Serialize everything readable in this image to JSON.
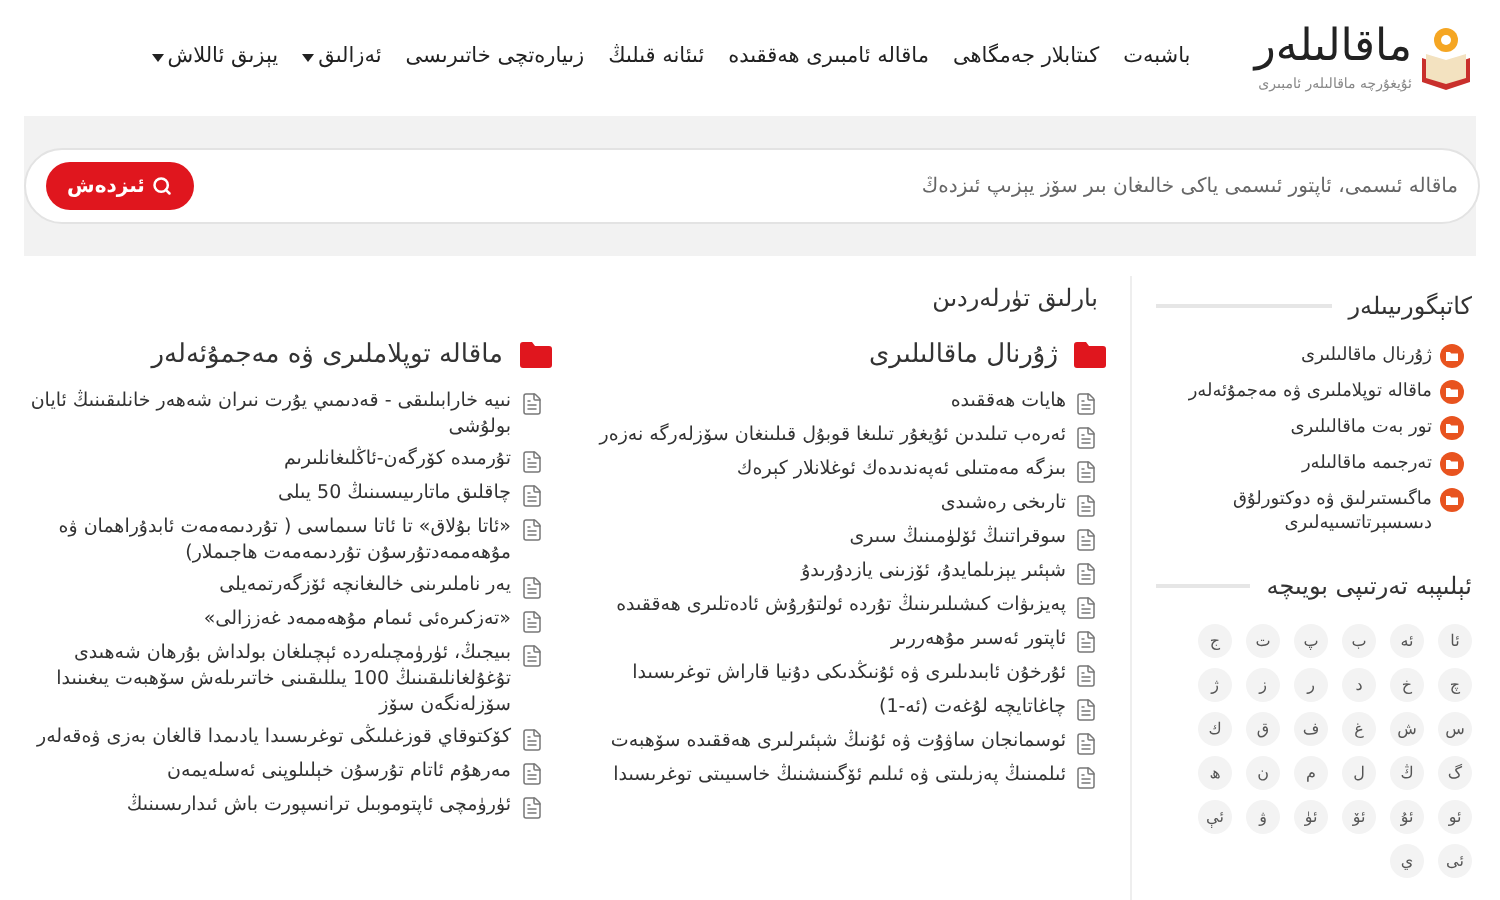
{
  "logo": {
    "title": "ماقالىلەر",
    "subtitle": "ئۇيغۇرچە ماقالىلەر ئامبىرى"
  },
  "nav": [
    {
      "label": "باشبەت",
      "kind": "link"
    },
    {
      "label": "كىتابلار جەمگاھى",
      "kind": "link"
    },
    {
      "label": "ماقالە ئامبىرى ھەققىدە",
      "kind": "link"
    },
    {
      "label": "ئىئانە قىلىڭ",
      "kind": "link"
    },
    {
      "label": "زىيارەتچى خاتىرىسى",
      "kind": "link"
    },
    {
      "label": "ئەزالىق",
      "kind": "dropdown"
    },
    {
      "label": "يېزىق ئاللاش",
      "kind": "dropdown"
    }
  ],
  "search": {
    "placeholder": "ماقالە ئىسمى، ئاپتور ئىسمى ياكى خالىغان بىر سۆز يېزىپ ئىزدەڭ",
    "button": "ئىزدەش"
  },
  "main_heading": "بارلىق تۈرلەردىن",
  "sections": [
    {
      "title": "ژۇرنال ماقالىلىرى",
      "items": [
        "ھايات ھەققىدە",
        "ئەرەب تىلىدىن ئۇيغۇر تىلىغا قوبۇل قىلىنغان سۆزلەرگە نەزەر",
        "بىزگە مەمتىلى ئەپەندىدەك ئوغلانلار كېرەك",
        "تارىخى رەشىدى",
        "سوقراتنىڭ ئۆلۈمىنىڭ سىرى",
        "شېئىر يېزىلمايدۇ، ئۆزىنى يازدۇرىدۇ",
        "پەيزىۋات كىشىلىرىنىڭ تۇردە ئولتۇرۇش ئادەتلىرى ھەققىدە",
        "ئاپتور ئەسىر مۇھەررىر",
        "ئۇرخۇن ئابىدىلىرى ۋە ئۇنىڭدىكى دۇنيا قاراش توغرىسىدا",
        "چاغاتايچە لۇغەت (ئە-1)",
        "ئوسمانجان ساۋۇت ۋە ئۇنىڭ شېئىرلىرى ھەققىدە سۆھبەت",
        "ئىلمىنىڭ پەزىلىتى ۋە ئىلىم ئۆگىنىشنىڭ خاسىيىتى توغرىسىدا"
      ]
    },
    {
      "title": "ماقالە توپلاملىرى ۋە مەجمۇئەلەر",
      "items": [
        "نىيە خارابىلىقى - قەدىمىي يۇرت نىران شەھەر خانلىقىنىڭ ئايان بولۇشى",
        "تۇرمىدە كۆرگەن-ئاڭلىغانلىرىم",
        "چاقلىق ماتارىيىسىنىڭ 50 يىلى",
        "«ئاتا بۇلاق» تا ئاتا سىماسى ( تۇردىمەمەت ئابدۇراھمان ۋە مۇھەممەدتۇرسۇن تۇردىمەمەت ھاجىملار)",
        "يەر ناملىرىنى خالىغانچە ئۆزگەرتمەيلى",
        "«تەزكىرەئى ئىمام مۇھەممەد غەززالى»",
        "بىيجىڭ، ئۈرۈمچىلەردە ئېچىلغان بولداش بۇرھان شەھىدى تۇغۇلغانلىقىنىڭ 100 يىللىقىنى خاتىرىلەش سۆھبەت يىغىنىدا سۆزلەنگەن سۆز",
        "كۆكتوقاي قوزغىلىڭى توغرىسىدا يادىمدا قالغان بەزى ۋەقەلەر",
        "مەرھۇم ئاتام تۇرسۇن خېلىلوپنى ئەسلەيمەن",
        "ئۈرۈمچى ئاپتوموبىل ترانسپورت باش ئىدارىسىنىڭ"
      ]
    }
  ],
  "sidebar": {
    "categories_title": "كاتېگورىيىلەر",
    "categories": [
      "ژۇرنال ماقالىلىرى",
      "ماقالە توپلاملىرى ۋە مەجمۇئەلەر",
      "تور بەت ماقالىلىرى",
      "تەرجىمە ماقالىلەر",
      "ماگىستىرلىق ۋە دوكتورلۇق دىسسېرتاتسىيەلىرى"
    ],
    "alphabet_title": "ئېلىپبە تەرتىپى بويىچە",
    "letters": [
      "ئا",
      "ئە",
      "ب",
      "پ",
      "ت",
      "ج",
      "چ",
      "خ",
      "د",
      "ر",
      "ز",
      "ژ",
      "س",
      "ش",
      "غ",
      "ف",
      "ق",
      "ك",
      "گ",
      "ڭ",
      "ل",
      "م",
      "ن",
      "ھ",
      "ئو",
      "ئۇ",
      "ئۆ",
      "ئۈ",
      "ۋ",
      "ئې",
      "ئى",
      "ي"
    ]
  }
}
